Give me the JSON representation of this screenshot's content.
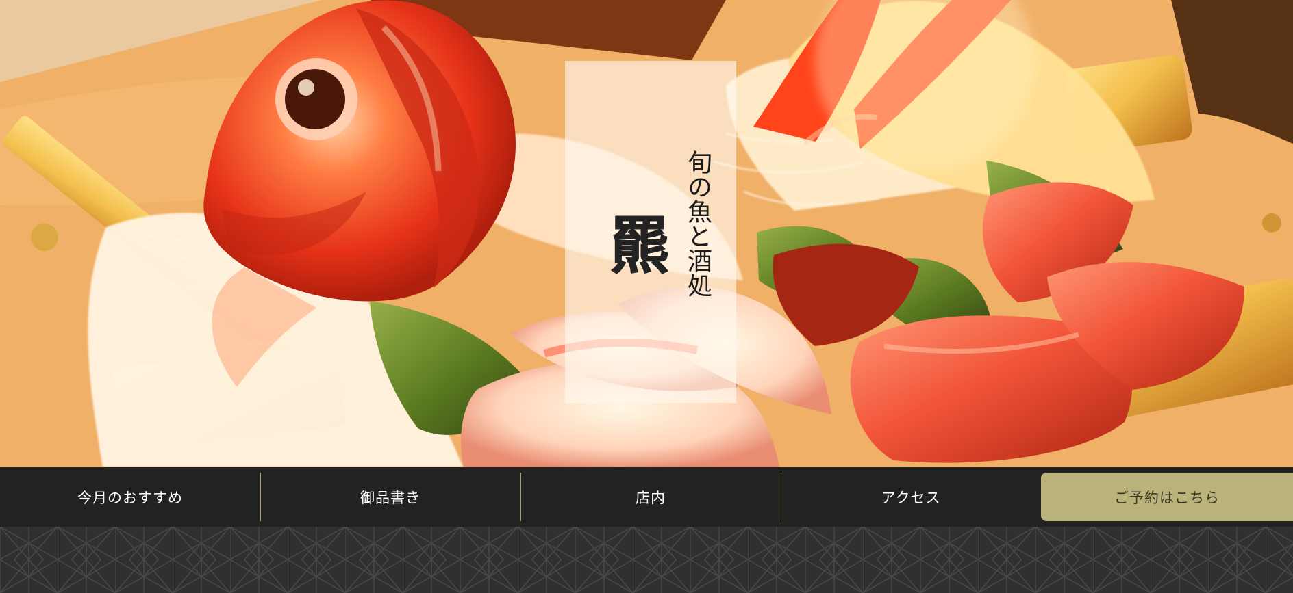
{
  "hero": {
    "tagline": "旬の魚と酒処",
    "brand_mark": "羆",
    "image_subject": "sashimi-platter"
  },
  "navigation": {
    "items": [
      {
        "label": "今月のおすすめ"
      },
      {
        "label": "御品書き"
      },
      {
        "label": "店内"
      },
      {
        "label": "アクセス"
      }
    ],
    "reservation_label": "ご予約はこちら"
  },
  "colors": {
    "nav_background": "#222222",
    "divider_gold": "#b49c66",
    "reservation_button": "#b9b27a",
    "pattern_background": "#303030",
    "pattern_lines": "#4a4a4a"
  }
}
